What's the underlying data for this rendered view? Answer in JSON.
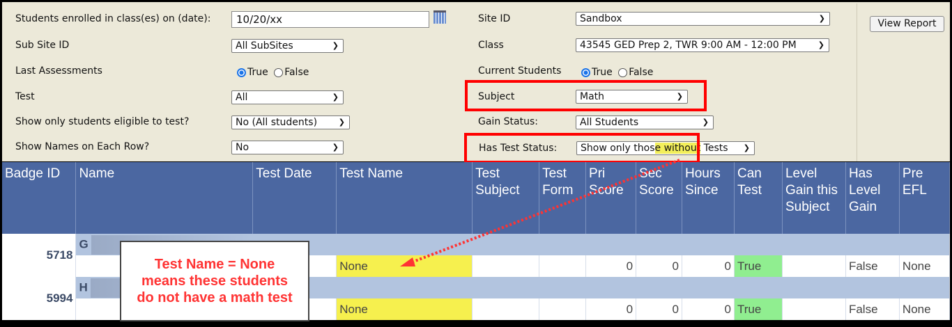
{
  "filters": {
    "enrolled_label": "Students enrolled in class(es) on (date):",
    "enrolled_value": "10/20/xx",
    "subsite_label": "Sub Site ID",
    "subsite_value": "All SubSites",
    "last_assess_label": "Last Assessments",
    "last_assess_true": "True",
    "last_assess_false": "False",
    "last_assess_selected": "True",
    "test_label": "Test",
    "test_value": "All",
    "eligible_label": "Show only students eligible to test?",
    "eligible_value": "No (All students)",
    "names_label": "Show Names on Each Row?",
    "names_value": "No",
    "site_label": "Site ID",
    "site_value": "Sandbox",
    "class_label": "Class",
    "class_value": "43545 GED Prep 2, TWR 9:00 AM - 12:00 PM",
    "current_label": "Current Students",
    "current_true": "True",
    "current_false": "False",
    "current_selected": "True",
    "subject_label": "Subject",
    "subject_value": "Math",
    "gain_label": "Gain Status:",
    "gain_value": "All Students",
    "hastest_label": "Has Test Status:",
    "hastest_value_pre": "Show only thos",
    "hastest_value_hl": "e without",
    "hastest_value_post": " Tests",
    "view_report": "View Report"
  },
  "table": {
    "headers": [
      "Badge ID",
      "Name",
      "Test Date",
      "Test Name",
      "Test Subject",
      "Test Form",
      "Pri Score",
      "Sec Score",
      "Hours Since",
      "Can Test",
      "Level Gain this Subject",
      "Has Level Gain",
      "Pre EFL"
    ],
    "students": [
      {
        "badge": "5718",
        "name_initial": "G",
        "test_name": "None",
        "pri": "0",
        "sec": "0",
        "hours": "0",
        "can_test": "True",
        "has_gain": "False",
        "pre_efl": "None"
      },
      {
        "badge": "5994",
        "name_initial": "H",
        "test_name": "None",
        "pri": "0",
        "sec": "0",
        "hours": "0",
        "can_test": "True",
        "has_gain": "False",
        "pre_efl": "None"
      }
    ]
  },
  "callout": {
    "line1": "Test Name = None",
    "line2": "means these students",
    "line3": "do not have a math test"
  },
  "colors": {
    "header": "#4b67a1",
    "group_row": "#b2c4df",
    "highlight": "#f6f04e",
    "can_test": "#90ee90",
    "annotation": "#ff0000"
  }
}
